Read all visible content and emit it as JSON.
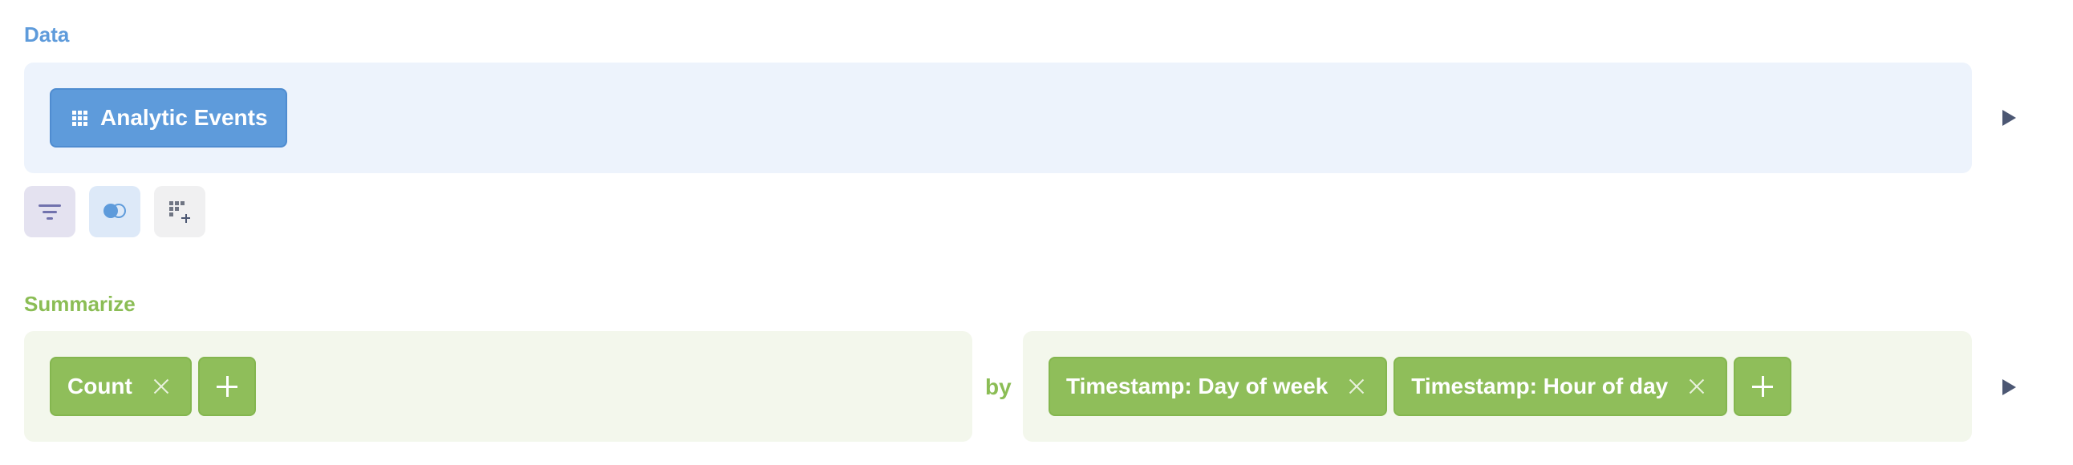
{
  "data_section": {
    "title": "Data",
    "table_label": "Analytic Events",
    "table_icon": "grid-icon",
    "run_icon": "play-icon",
    "actions": [
      {
        "name": "filter",
        "icon": "filter-icon"
      },
      {
        "name": "join",
        "icon": "join-icon"
      },
      {
        "name": "custom-column",
        "icon": "custom-column-icon"
      }
    ]
  },
  "summarize_section": {
    "title": "Summarize",
    "metrics": [
      {
        "label": "Count"
      }
    ],
    "by_label": "by",
    "breakouts": [
      {
        "label": "Timestamp: Day of week"
      },
      {
        "label": "Timestamp: Hour of day"
      }
    ],
    "run_icon": "play-icon"
  },
  "colors": {
    "data_accent": "#5E9BDB",
    "data_panel_bg": "#EDF3FC",
    "summarize_accent": "#8FBE5A",
    "summarize_panel_bg": "#F3F7EC",
    "filter_accent": "#7172AD",
    "arrow": "#4C5773"
  }
}
